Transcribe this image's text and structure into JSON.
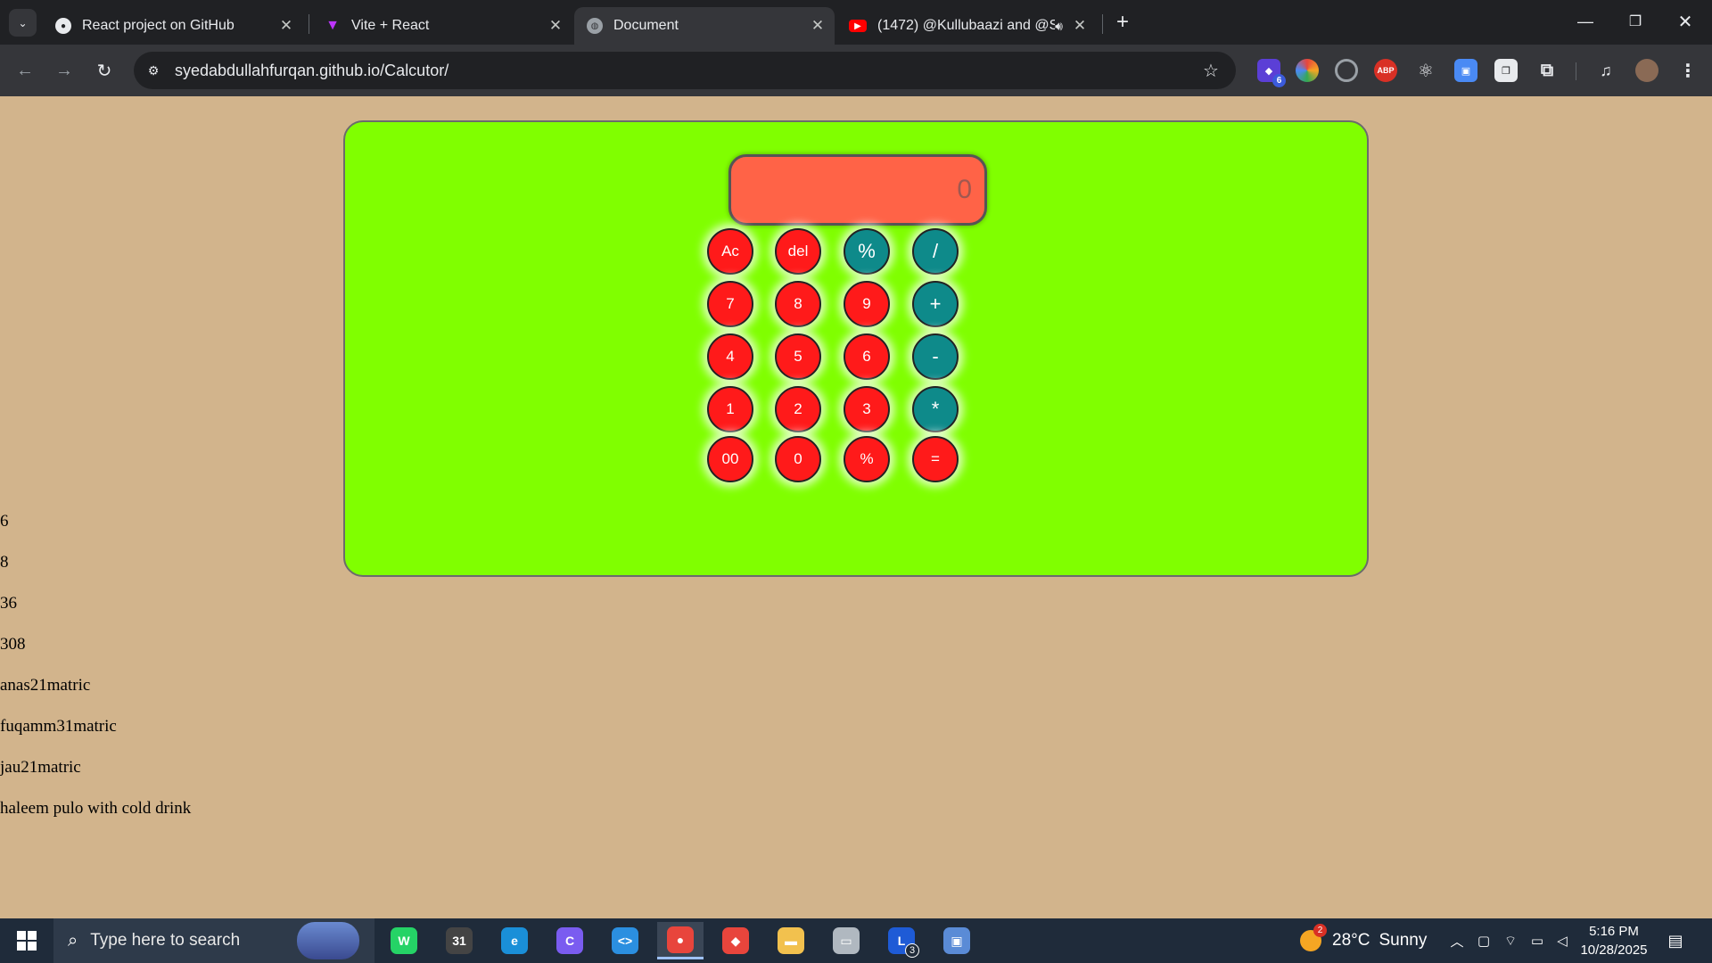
{
  "browser": {
    "tabs": [
      {
        "title": "React project on GitHub",
        "icon": "github-icon",
        "active": false
      },
      {
        "title": "Vite + React",
        "icon": "vite-icon",
        "active": false
      },
      {
        "title": "Document",
        "icon": "globe-icon",
        "active": true
      },
      {
        "title": "(1472) @Kullubaazi and @S",
        "icon": "youtube-icon",
        "active": false
      }
    ],
    "url": "syedabdullahfurqan.github.io/Calcutor/",
    "extensions": [
      {
        "icon": "extension-shield-icon",
        "badge": "6",
        "color": "#5b3fd6"
      },
      {
        "icon": "color-picker-icon",
        "badge": "",
        "color": "#e8453c"
      },
      {
        "icon": "target-icon",
        "badge": "",
        "color": "#9aa0a6"
      },
      {
        "icon": "adblock-icon",
        "label": "ABP",
        "badge": "",
        "color": "#d93025"
      },
      {
        "icon": "react-devtools-icon",
        "badge": "",
        "color": "#9aa0a6"
      },
      {
        "icon": "screenshot-icon",
        "badge": "",
        "color": "#4a8af4"
      },
      {
        "icon": "window-extension-icon",
        "badge": "",
        "color": "#4a8af4"
      },
      {
        "icon": "puzzle-icon",
        "badge": "",
        "color": "#9aa0a6"
      }
    ]
  },
  "calculator": {
    "display_value": "0",
    "keys": [
      {
        "label": "Ac",
        "kind": "num"
      },
      {
        "label": "del",
        "kind": "num"
      },
      {
        "label": "%",
        "kind": "op"
      },
      {
        "label": "/",
        "kind": "op"
      },
      {
        "label": "7",
        "kind": "num"
      },
      {
        "label": "8",
        "kind": "num"
      },
      {
        "label": "9",
        "kind": "num"
      },
      {
        "label": "+",
        "kind": "op"
      },
      {
        "label": "4",
        "kind": "num"
      },
      {
        "label": "5",
        "kind": "num"
      },
      {
        "label": "6",
        "kind": "num"
      },
      {
        "label": "-",
        "kind": "op"
      },
      {
        "label": "1",
        "kind": "num"
      },
      {
        "label": "2",
        "kind": "num"
      },
      {
        "label": "3",
        "kind": "num"
      },
      {
        "label": "*",
        "kind": "op"
      },
      {
        "label": "00",
        "kind": "num"
      },
      {
        "label": "0",
        "kind": "num"
      },
      {
        "label": "%",
        "kind": "num"
      },
      {
        "label": "=",
        "kind": "num"
      }
    ]
  },
  "output_lines": [
    "6",
    "8",
    "36",
    "308",
    "anas21matric",
    "fuqamm31matric",
    "jau21matric",
    "haleem pulo with cold drink"
  ],
  "taskbar": {
    "search_placeholder": "Type here to search",
    "apps": [
      {
        "name": "whatsapp-icon",
        "color": "#25d366",
        "label": "W"
      },
      {
        "name": "calendar-app-icon",
        "color": "#444",
        "label": "31"
      },
      {
        "name": "edge-icon",
        "color": "#1a8fd8",
        "label": "e"
      },
      {
        "name": "copilot-icon",
        "color": "#7a5cf0",
        "label": "C"
      },
      {
        "name": "vscode-icon",
        "color": "#2b8fe0",
        "label": "<>"
      },
      {
        "name": "chrome-icon",
        "color": "#e8453c",
        "label": "●"
      },
      {
        "name": "anydesk-icon",
        "color": "#e8453c",
        "label": "◆"
      },
      {
        "name": "file-explorer-icon",
        "color": "#f2c14e",
        "label": "▬"
      },
      {
        "name": "printer-app-icon",
        "color": "#b0b8c0",
        "label": "▭"
      },
      {
        "name": "l-app-icon",
        "color": "#1e5bd6",
        "label": "L",
        "badge": "3"
      },
      {
        "name": "network-app-icon",
        "color": "#5a8bd6",
        "label": "▣"
      }
    ],
    "weather": {
      "temp": "28°C",
      "condition": "Sunny",
      "badge": "2"
    },
    "time": "5:16 PM",
    "date": "10/28/2025"
  }
}
